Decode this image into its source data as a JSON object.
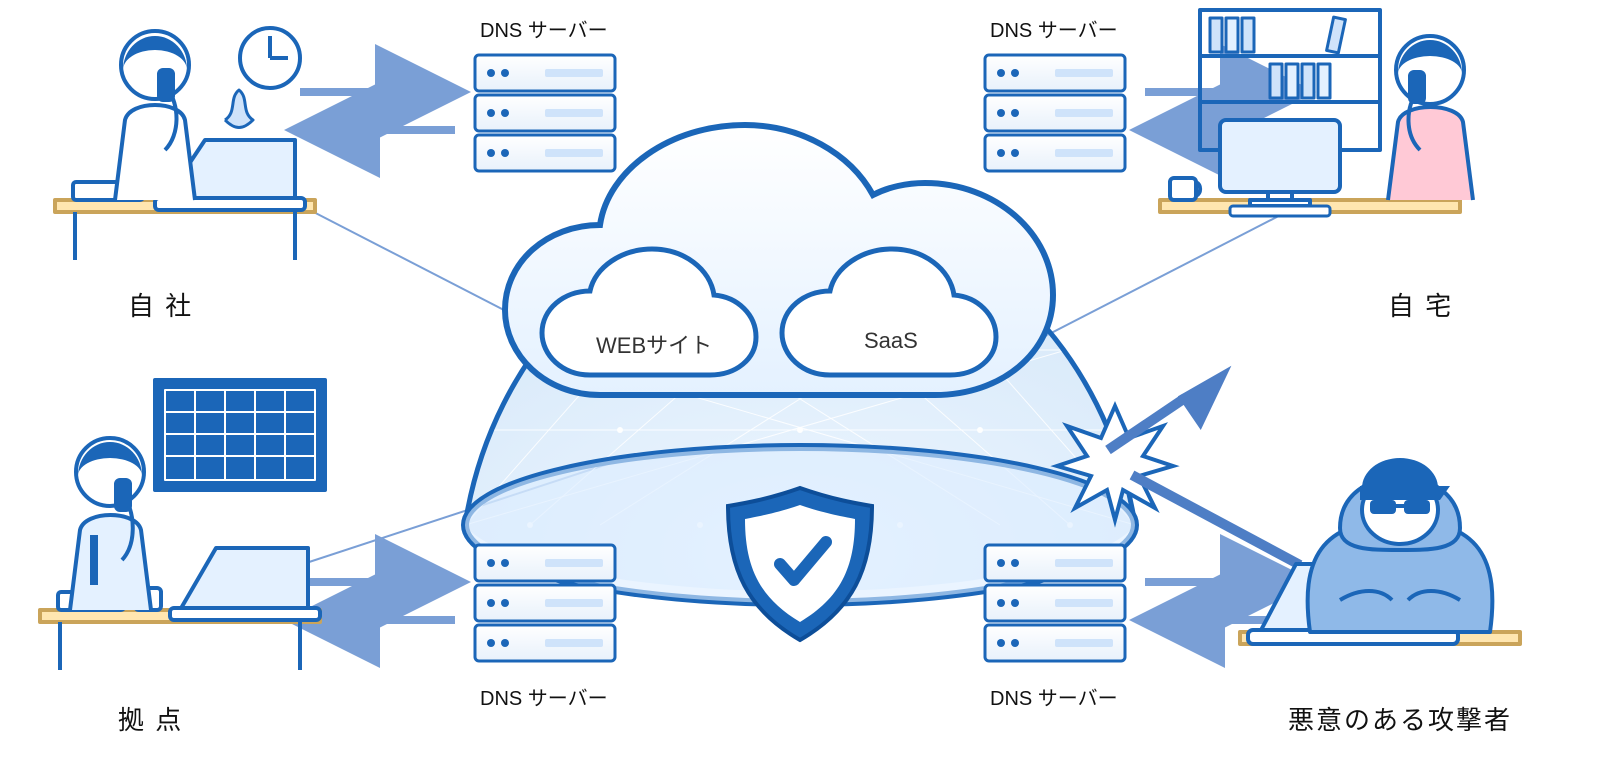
{
  "dns": {
    "tl": "DNS サーバー",
    "tr": "DNS サーバー",
    "bl": "DNS サーバー",
    "br": "DNS サーバー"
  },
  "cloud": {
    "web": "WEBサイト",
    "saas": "SaaS"
  },
  "endpoints": {
    "company": "自 社",
    "home": "自 宅",
    "branch": "拠 点",
    "attacker": "悪意のある攻撃者"
  }
}
